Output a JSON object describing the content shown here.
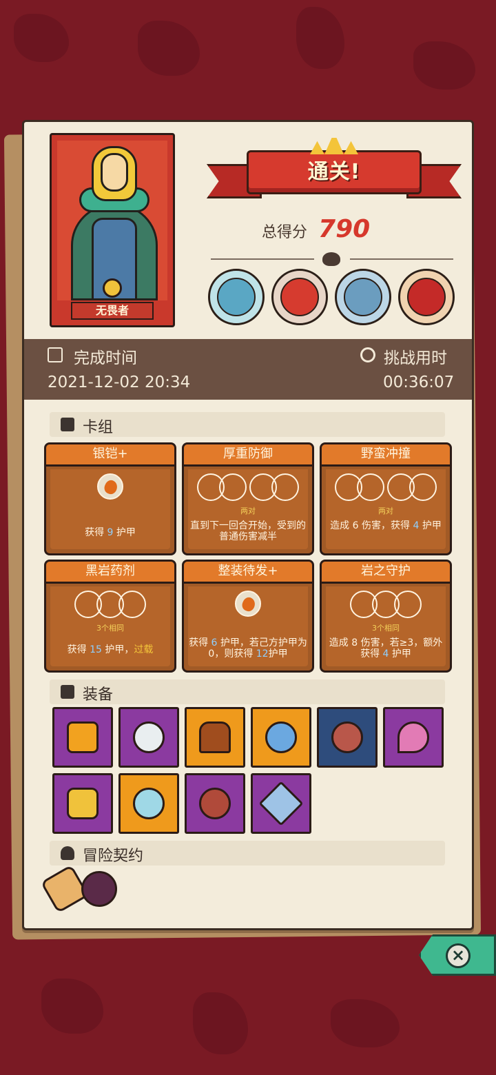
{
  "hero": {
    "name": "无畏者"
  },
  "result": {
    "banner": "通关!",
    "score_label": "总得分",
    "score": "790"
  },
  "bosses": [
    "boss-1",
    "boss-2",
    "boss-3",
    "boss-4"
  ],
  "stats": {
    "finish_label": "完成时间",
    "finish_value": "2021-12-02 20:34",
    "duration_label": "挑战用时",
    "duration_value": "00:36:07"
  },
  "deck": {
    "title": "卡组",
    "cards": [
      {
        "name": "银铠+",
        "desc_a": "获得 ",
        "num": "9",
        "desc_b": " 护甲"
      },
      {
        "name": "厚重防御",
        "note": "两对",
        "desc": "直到下一回合开始，受到的普通伤害减半"
      },
      {
        "name": "野蛮冲撞",
        "note": "两对",
        "desc_a": "造成 ",
        "dmg": "6",
        "desc_b": " 伤害，获得 ",
        "num": "4",
        "desc_c": " 护甲"
      },
      {
        "name": "黑岩药剂",
        "note": "3个相同",
        "desc_a": "获得 ",
        "num": "15",
        "desc_b": " 护甲，",
        "hy": "过载"
      },
      {
        "name": "整装待发+",
        "desc_a": "获得 ",
        "num": "6",
        "desc_b": " 护甲，若己方护甲为0，则获得 ",
        "num2": "12",
        "desc_c": "护甲"
      },
      {
        "name": "岩之守护",
        "note": "3个相同",
        "desc_a": "造成 ",
        "dmg": "8",
        "desc_b": " 伤害，若",
        "cond": "≥3",
        "desc_c": "，额外获得 ",
        "num": "4",
        "desc_d": " 护甲"
      }
    ]
  },
  "equipment": {
    "title": "装备"
  },
  "contract": {
    "title": "冒险契约"
  },
  "icons": [
    "film-icon",
    "stopwatch-icon",
    "cards-icon",
    "cube-icon",
    "person-icon",
    "close-icon"
  ]
}
